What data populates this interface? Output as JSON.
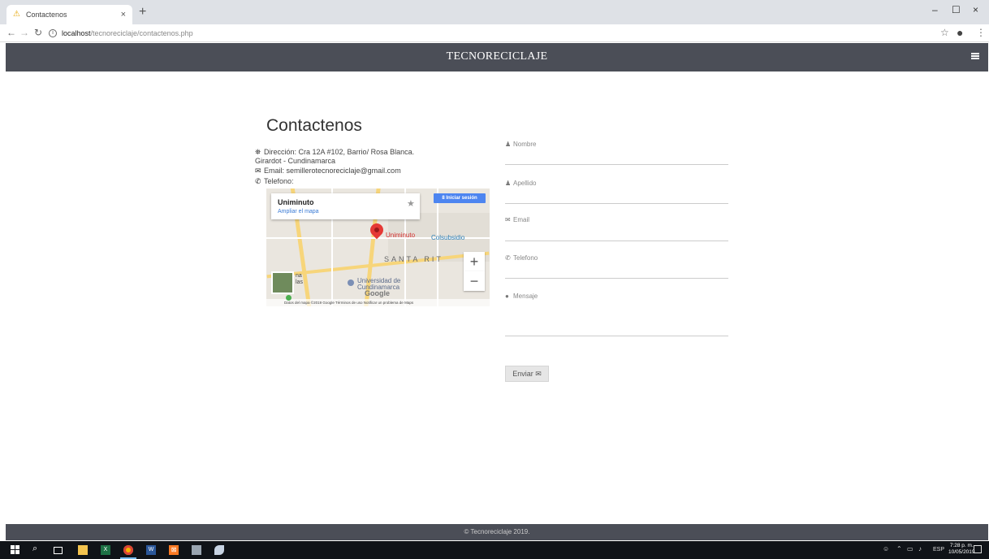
{
  "browser": {
    "tab_title": "Contactenos",
    "tab_close": "×",
    "new_tab": "+",
    "address_host": "localhost",
    "address_path": "/tecnoreciclaje/contactenos.php",
    "win_min": "–",
    "win_max": "☐",
    "win_close": "×"
  },
  "site": {
    "title": "TECNORECICLAJE",
    "footer": "© Tecnoreciclaje 2019."
  },
  "contact": {
    "heading": "Contactenos",
    "address_line1": "Dirección: Cra 12A #102, Barrio/ Rosa Blanca.",
    "address_line2": "Girardot - Cundinamarca",
    "email": "Email: semillerotecnoreciclaje@gmail.com",
    "phone": "Telefono:"
  },
  "map": {
    "place_name": "Uniminuto",
    "enlarge_link": "Ampliar el mapa",
    "signin_button": "8 Iniciar sesión",
    "pin_label": "Uniminuto",
    "label_colsubsidio": "Colsubsidio",
    "label_santa": "SANTA RIT",
    "label_univ": "Universidad de Cundinamarca",
    "label_thumb": "na las",
    "google": "Google",
    "zoom_in": "+",
    "zoom_out": "−",
    "attribution": "Datos del mapa ©2019 Google   Términos de uso   Notificar un problema de Maps"
  },
  "form": {
    "nombre_label": "Nombre",
    "apellido_label": "Apellido",
    "email_label": "Email",
    "telefono_label": "Telefono",
    "mensaje_label": "Mensaje",
    "submit_label": "Enviar ✉"
  },
  "taskbar": {
    "lang": "ESP",
    "time": "7:28 p. m.",
    "date": "10/05/2019"
  }
}
